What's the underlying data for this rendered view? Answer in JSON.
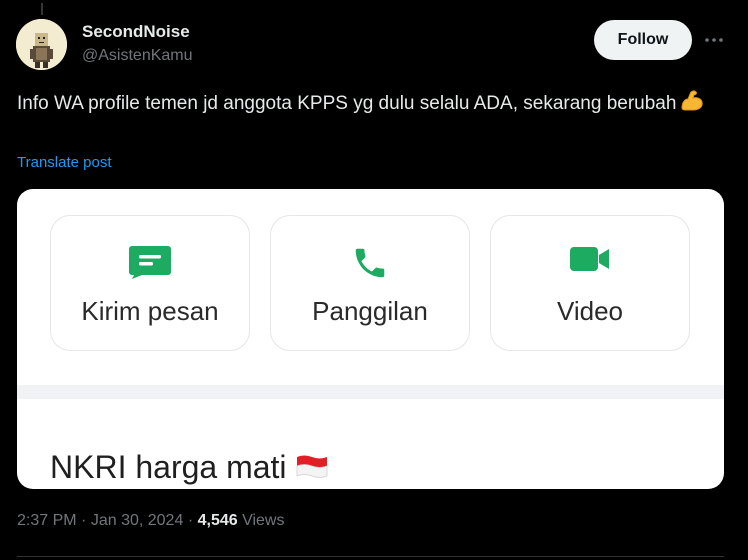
{
  "author": {
    "display_name": "SecondNoise",
    "handle": "@AsistenKamu",
    "avatar_icon": "pixel-art-avatar"
  },
  "header": {
    "follow_label": "Follow",
    "more_icon": "more-horizontal-icon"
  },
  "post": {
    "text": "Info WA profile temen jd anggota KPPS yg dulu selalu ADA, sekarang berubah",
    "emoji": "flexed-biceps-emoji",
    "translate_label": "Translate post"
  },
  "media": {
    "actions": [
      {
        "label": "Kirim pesan",
        "icon": "message-icon"
      },
      {
        "label": "Panggilan",
        "icon": "phone-icon"
      },
      {
        "label": "Video",
        "icon": "video-icon"
      }
    ],
    "about_text": "NKRI harga mati",
    "about_emoji": "indonesia-flag-icon",
    "accent_color": "#1daa61"
  },
  "meta": {
    "time": "2:37 PM",
    "separator": "·",
    "date": "Jan 30, 2024",
    "views_count": "4,546",
    "views_label": "Views"
  },
  "colors": {
    "background": "#000000",
    "text_primary": "#e7e9ea",
    "text_secondary": "#71767b",
    "link": "#1d9bf0"
  }
}
